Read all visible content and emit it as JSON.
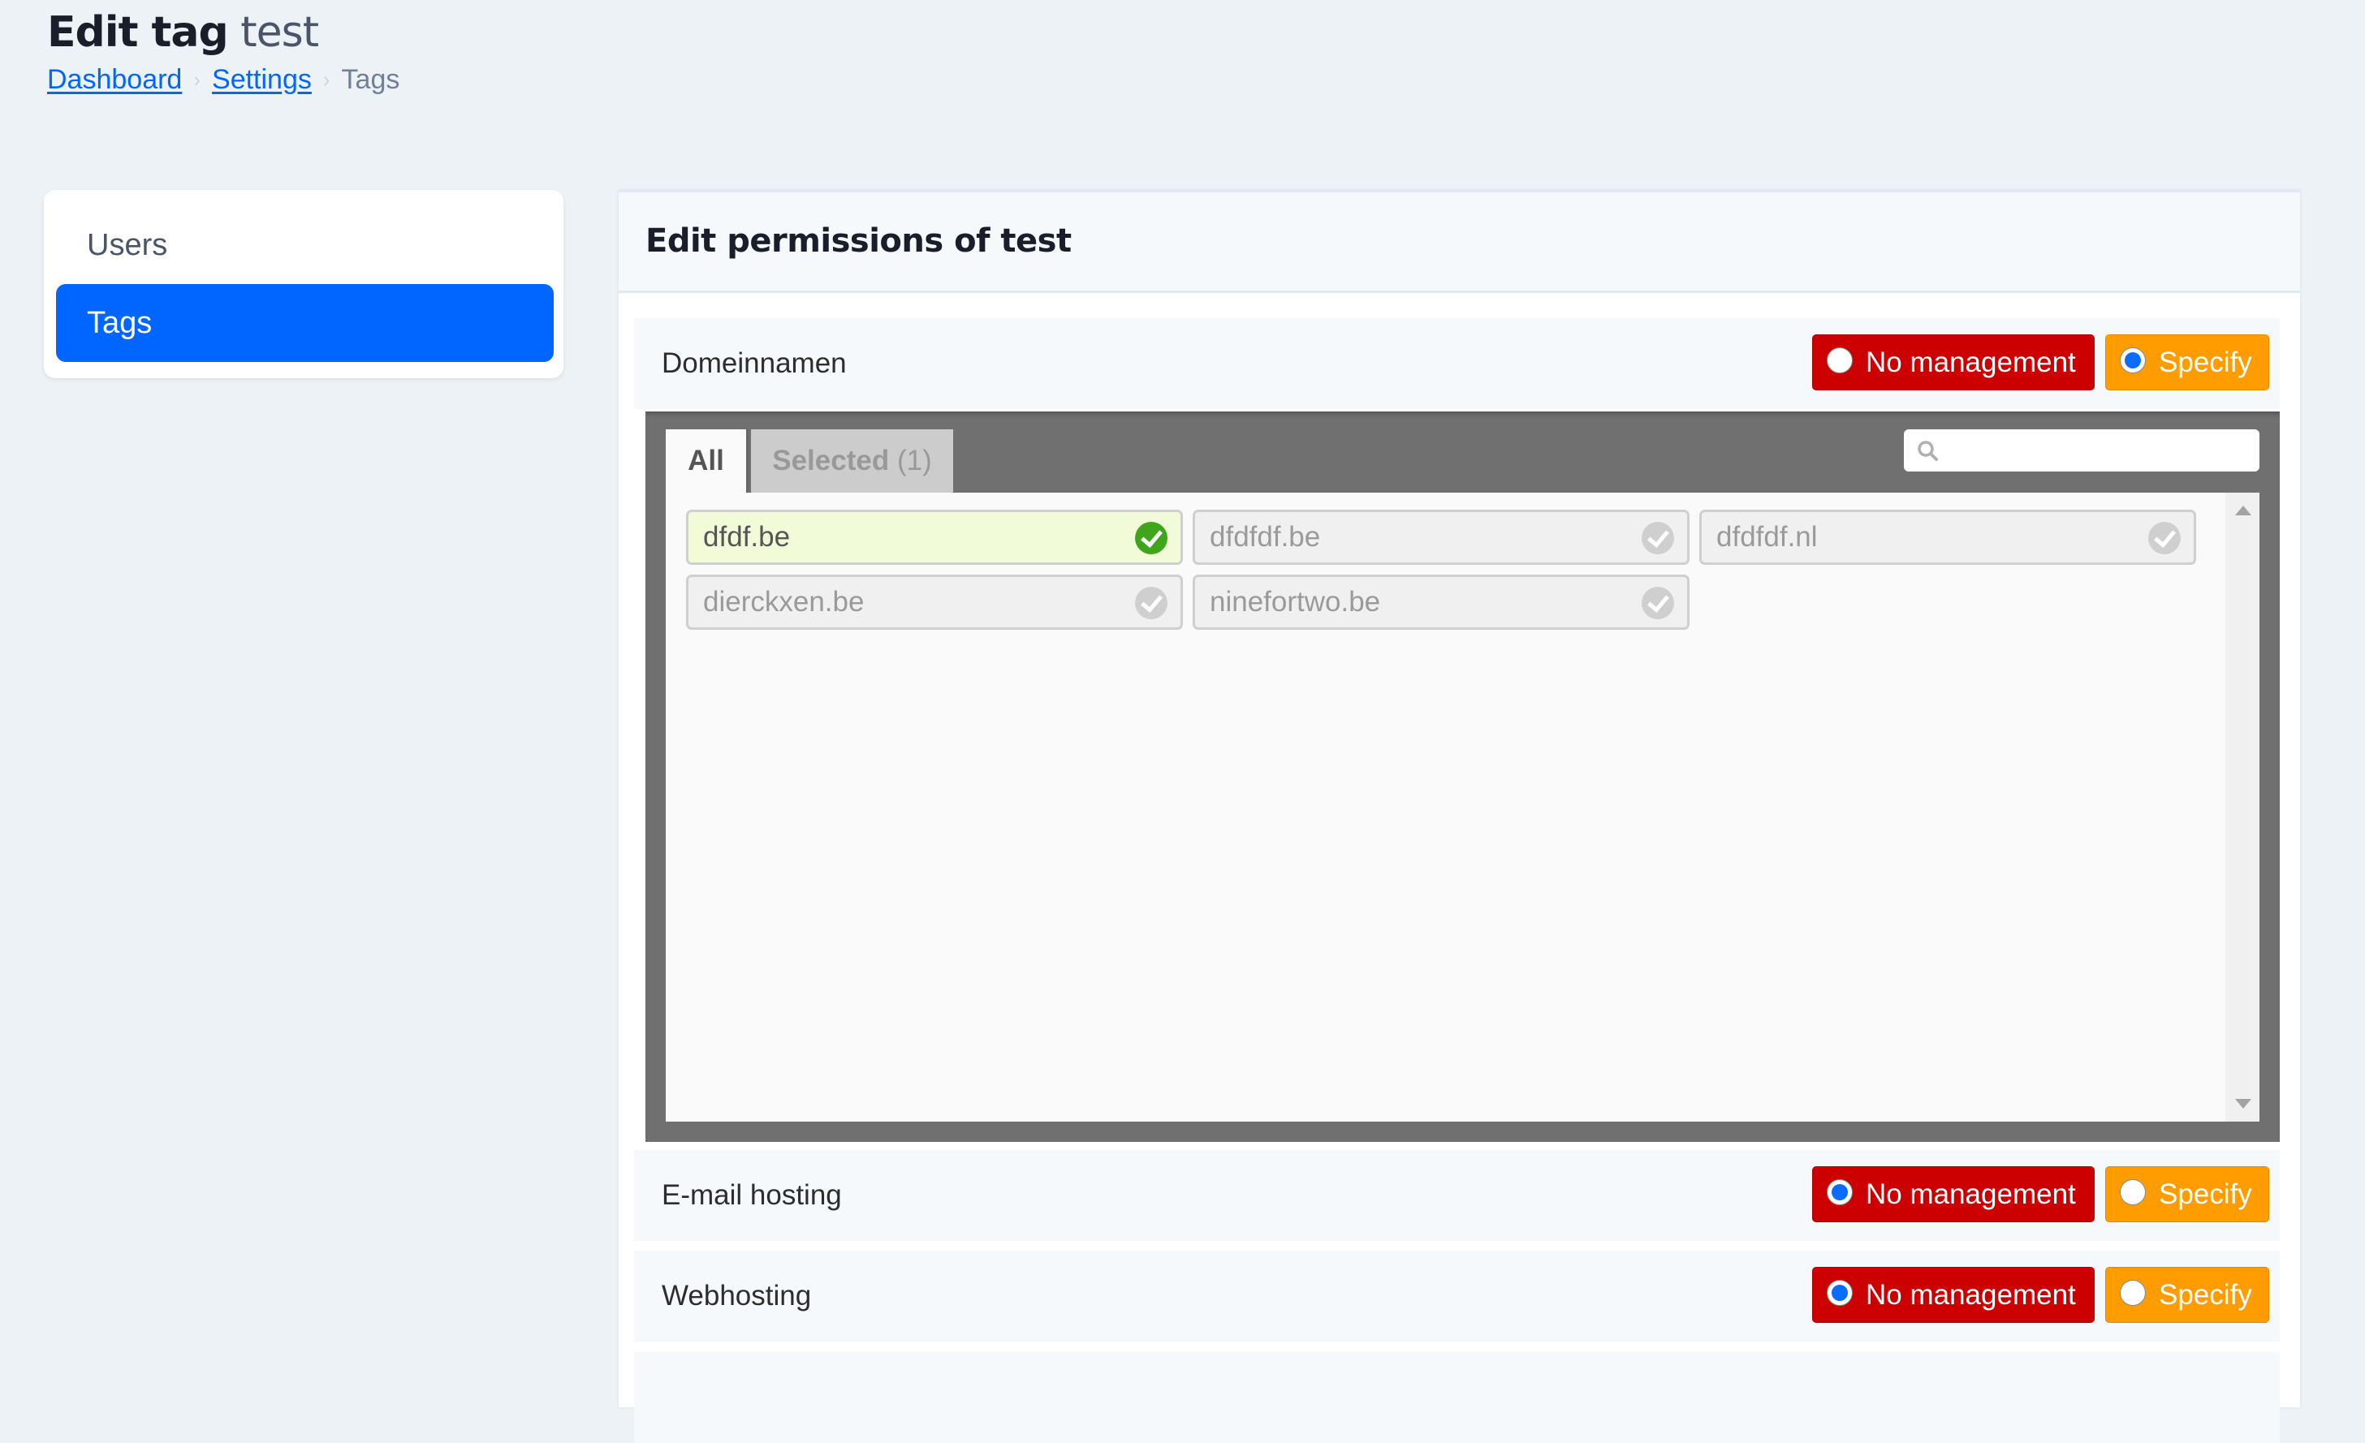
{
  "header": {
    "title_strong": "Edit tag",
    "title_light": "test",
    "breadcrumb": [
      {
        "label": "Dashboard",
        "link": true
      },
      {
        "label": "Settings",
        "link": true
      },
      {
        "label": "Tags",
        "link": false
      }
    ],
    "breadcrumb_separator": "›"
  },
  "sidebar": {
    "items": [
      {
        "label": "Users",
        "active": false
      },
      {
        "label": "Tags",
        "active": true
      }
    ]
  },
  "main": {
    "title": "Edit permissions of test",
    "no_management_label": "No management",
    "specify_label": "Specify",
    "sections": [
      {
        "label": "Domeinnamen",
        "selected_option": "Specify",
        "picker": {
          "tabs": [
            {
              "label": "All",
              "active": true
            },
            {
              "label": "Selected",
              "count": "(1)",
              "active": false
            }
          ],
          "search": {
            "value": "",
            "placeholder": ""
          },
          "items": [
            {
              "label": "dfdf.be",
              "selected": true
            },
            {
              "label": "dfdfdf.be",
              "selected": false
            },
            {
              "label": "dfdfdf.nl",
              "selected": false
            },
            {
              "label": "dierckxen.be",
              "selected": false
            },
            {
              "label": "ninefortwo.be",
              "selected": false
            }
          ]
        }
      },
      {
        "label": "E-mail hosting",
        "selected_option": "No management"
      },
      {
        "label": "Webhosting",
        "selected_option": "No management"
      }
    ]
  },
  "colors": {
    "accent": "#0066ff",
    "no_management": "#cc0000",
    "specify": "#ff9d00",
    "selected_item_bg": "#f1fbd8",
    "check_selected": "#3fa51a"
  }
}
